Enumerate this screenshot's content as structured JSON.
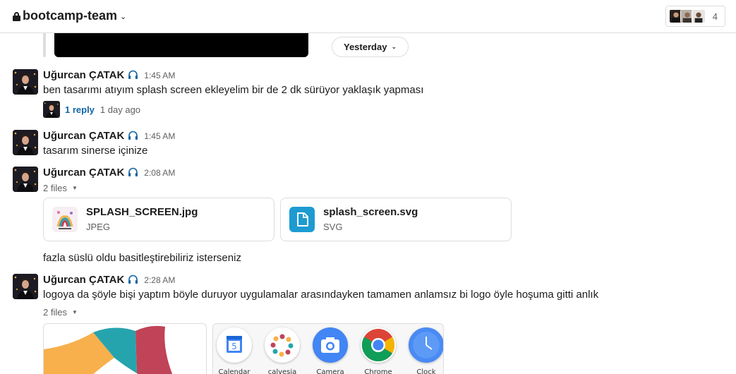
{
  "header": {
    "channel_name": "bootcamp-team",
    "member_count": "4"
  },
  "date_divider": "Yesterday",
  "messages": [
    {
      "author": "Uğurcan ÇATAK",
      "time": "1:45 AM",
      "text": "ben tasarımı atıyım splash screen ekleyelim bir de 2 dk sürüyor yaklaşık yapması",
      "thread": {
        "reply_label": "1 reply",
        "last_reply": "1 day ago"
      }
    },
    {
      "author": "Uğurcan ÇATAK",
      "time": "1:45 AM",
      "text": "tasarım sinerse içinize"
    },
    {
      "author": "Uğurcan ÇATAK",
      "time": "2:08 AM",
      "files_label": "2 files",
      "files": [
        {
          "name": "SPLASH_SCREEN.jpg",
          "type": "JPEG",
          "icon": "image-thumbnail"
        },
        {
          "name": "splash_screen.svg",
          "type": "SVG",
          "icon": "file-icon"
        }
      ],
      "followup": "fazla süslü oldu basitleştirebiliriz isterseniz"
    },
    {
      "author": "Uğurcan ÇATAK",
      "time": "2:28 AM",
      "text": "logoya da şöyle bişi yaptım böyle duruyor uygulamalar arasındayken tamamen anlamsız bi logo öyle hoşuma gitti anlık",
      "files_label": "2 files",
      "apps": [
        {
          "label": "Calendar",
          "icon": "calendar-icon",
          "digit": "5"
        },
        {
          "label": "calvesia",
          "icon": "calvesia-logo-icon"
        },
        {
          "label": "Camera",
          "icon": "camera-icon"
        },
        {
          "label": "Chrome",
          "icon": "chrome-icon"
        },
        {
          "label": "Clock",
          "icon": "clock-icon"
        }
      ]
    }
  ],
  "colors": {
    "link": "#1264a3",
    "muted": "#616061",
    "border": "#dddddd",
    "svg_icon_bg": "#1d9bd1",
    "logo_orange": "#f8b04c",
    "logo_teal": "#26a4ad",
    "logo_red": "#c04357"
  }
}
